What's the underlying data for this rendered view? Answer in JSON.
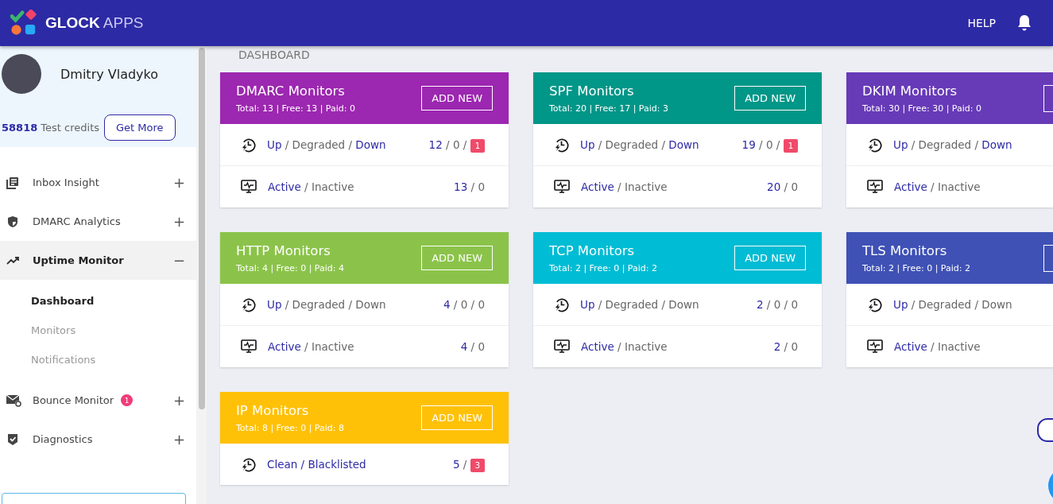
{
  "header": {
    "logo_bold": "GLOCK",
    "logo_light": "APPS",
    "help": "HELP"
  },
  "user": {
    "name": "Dmitry Vladyko",
    "credits": "58818",
    "credits_label": "Test credits",
    "button": "Get More"
  },
  "nav": [
    {
      "label": "Inbox Insight",
      "kind": "news",
      "expanded": false,
      "toggle": "+"
    },
    {
      "label": "DMARC Analytics",
      "kind": "shield",
      "expanded": false,
      "toggle": "+"
    },
    {
      "label": "Uptime Monitor",
      "kind": "trend",
      "expanded": true,
      "toggle": "−",
      "children": [
        {
          "label": "Dashboard",
          "selected": true
        },
        {
          "label": "Monitors",
          "selected": false
        },
        {
          "label": "Notifications",
          "selected": false
        }
      ]
    },
    {
      "label": "Bounce Monitor",
      "kind": "mail",
      "expanded": false,
      "toggle": "+",
      "badge": "1"
    },
    {
      "label": "Diagnostics",
      "kind": "check",
      "expanded": false,
      "toggle": "+"
    }
  ],
  "breadcrumb": "DASHBOARD",
  "cards": [
    {
      "title": "DMARC Monitors",
      "color": "#9c27b0",
      "summary": "Total: 13 | Free: 13 | Paid: 0",
      "button": "ADD NEW",
      "rows": [
        {
          "kind": "status",
          "label": [
            {
              "text": "Up",
              "highlighted": true
            },
            {
              "text": " / Degraded / ",
              "highlighted": false
            },
            {
              "text": "Down",
              "highlighted": true
            }
          ],
          "values": [
            {
              "text": "12",
              "highlighted": true,
              "alert": false
            },
            {
              "text": " / 0 / ",
              "highlighted": false,
              "alert": false
            },
            {
              "text": "1",
              "highlighted": false,
              "alert": true
            }
          ]
        },
        {
          "kind": "activity",
          "label": [
            {
              "text": "Active",
              "highlighted": true
            },
            {
              "text": " / Inactive",
              "highlighted": false
            }
          ],
          "values": [
            {
              "text": "13",
              "highlighted": true,
              "alert": false
            },
            {
              "text": " / 0",
              "highlighted": false,
              "alert": false
            }
          ]
        }
      ]
    },
    {
      "title": "SPF Monitors",
      "color": "#009688",
      "summary": "Total: 20 | Free: 17 | Paid: 3",
      "button": "ADD NEW",
      "rows": [
        {
          "kind": "status",
          "label": [
            {
              "text": "Up",
              "highlighted": true
            },
            {
              "text": " / Degraded / ",
              "highlighted": false
            },
            {
              "text": "Down",
              "highlighted": true
            }
          ],
          "values": [
            {
              "text": "19",
              "highlighted": true,
              "alert": false
            },
            {
              "text": " / 0 / ",
              "highlighted": false,
              "alert": false
            },
            {
              "text": "1",
              "highlighted": false,
              "alert": true
            }
          ]
        },
        {
          "kind": "activity",
          "label": [
            {
              "text": "Active",
              "highlighted": true
            },
            {
              "text": " / Inactive",
              "highlighted": false
            }
          ],
          "values": [
            {
              "text": "20",
              "highlighted": true,
              "alert": false
            },
            {
              "text": " / 0",
              "highlighted": false,
              "alert": false
            }
          ]
        }
      ]
    },
    {
      "title": "DKIM Monitors",
      "color": "#673ab7",
      "summary": "Total: 30 | Free: 30 | Paid: 0",
      "rows": [
        {
          "kind": "status",
          "label": [
            {
              "text": "Up",
              "highlighted": true
            },
            {
              "text": " / Degraded / ",
              "highlighted": false
            },
            {
              "text": "Down",
              "highlighted": true
            }
          ]
        },
        {
          "kind": "activity",
          "label": [
            {
              "text": "Active",
              "highlighted": true
            },
            {
              "text": " / Inactive",
              "highlighted": false
            }
          ]
        }
      ]
    },
    {
      "title": "HTTP Monitors",
      "color": "#8bc34a",
      "summary": "Total: 4 | Free: 0 | Paid: 4",
      "button": "ADD NEW",
      "rows": [
        {
          "kind": "status",
          "label": [
            {
              "text": "Up",
              "highlighted": true
            },
            {
              "text": " / Degraded / Down",
              "highlighted": false
            }
          ],
          "values": [
            {
              "text": "4",
              "highlighted": true,
              "alert": false
            },
            {
              "text": " / 0 / 0",
              "highlighted": false,
              "alert": false
            }
          ]
        },
        {
          "kind": "activity",
          "label": [
            {
              "text": "Active",
              "highlighted": true
            },
            {
              "text": " / Inactive",
              "highlighted": false
            }
          ],
          "values": [
            {
              "text": "4",
              "highlighted": true,
              "alert": false
            },
            {
              "text": " / 0",
              "highlighted": false,
              "alert": false
            }
          ]
        }
      ]
    },
    {
      "title": "TCP Monitors",
      "color": "#00bcd4",
      "summary": "Total: 2 | Free: 0 | Paid: 2",
      "button": "ADD NEW",
      "rows": [
        {
          "kind": "status",
          "label": [
            {
              "text": "Up",
              "highlighted": true
            },
            {
              "text": " / Degraded / Down",
              "highlighted": false
            }
          ],
          "values": [
            {
              "text": "2",
              "highlighted": true,
              "alert": false
            },
            {
              "text": " / 0 / 0",
              "highlighted": false,
              "alert": false
            }
          ]
        },
        {
          "kind": "activity",
          "label": [
            {
              "text": "Active",
              "highlighted": true
            },
            {
              "text": " / Inactive",
              "highlighted": false
            }
          ],
          "values": [
            {
              "text": "2",
              "highlighted": true,
              "alert": false
            },
            {
              "text": " / 0",
              "highlighted": false,
              "alert": false
            }
          ]
        }
      ]
    },
    {
      "title": "TLS Monitors",
      "color": "#3f51b5",
      "summary": "Total: 2 | Free: 0 | Paid: 2",
      "rows": [
        {
          "kind": "status",
          "label": [
            {
              "text": "Up",
              "highlighted": true
            },
            {
              "text": " / Degraded / Down",
              "highlighted": false
            }
          ]
        },
        {
          "kind": "activity",
          "label": [
            {
              "text": "Active",
              "highlighted": true
            },
            {
              "text": " / Inactive",
              "highlighted": false
            }
          ]
        }
      ]
    },
    {
      "title": "IP Monitors",
      "color": "#ffc107",
      "summary": "Total: 8 | Free: 0 | Paid: 8",
      "button": "ADD NEW",
      "rows": [
        {
          "kind": "status",
          "label": [
            {
              "text": "Clean / Blacklisted",
              "highlighted": true
            }
          ],
          "values": [
            {
              "text": "5",
              "highlighted": true,
              "alert": false
            },
            {
              "text": " / ",
              "highlighted": false,
              "alert": false
            },
            {
              "text": "3",
              "highlighted": false,
              "alert": true
            }
          ]
        }
      ]
    }
  ]
}
